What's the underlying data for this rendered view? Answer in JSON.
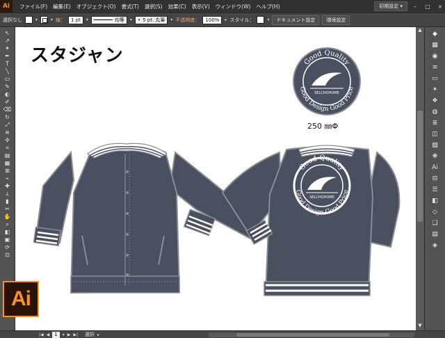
{
  "app": {
    "logo": "Ai",
    "badge": "Ai"
  },
  "menu": [
    "ファイル(F)",
    "編集(E)",
    "オブジェクト(O)",
    "書式(T)",
    "選択(S)",
    "効果(C)",
    "表示(V)",
    "ウィンドウ(W)",
    "ヘルプ(H)"
  ],
  "menubar_right": {
    "workspace": "初期設定",
    "workspace_caret": "▾",
    "minimize": "–",
    "maximize": "□",
    "close": "×"
  },
  "control": {
    "selection": "選択なし",
    "stroke_label": "線：",
    "stroke_weight": "1 pt",
    "profile": "均等",
    "brush": "5 pt. 丸筆",
    "opacity_label": "不透明度：",
    "opacity": "100%",
    "style_label": "スタイル：",
    "doc_settings": "ドキュメント設定",
    "prefs": "環境設定"
  },
  "tools": [
    "↖",
    "↗",
    "✶",
    "✒",
    "T",
    "╲",
    "▭",
    "✎",
    "◐",
    "✐",
    "⌫",
    "↻",
    "⤢",
    "≋",
    "✣",
    "⌗",
    "▤",
    "▦",
    "⊞",
    "⌁",
    "✚",
    "⟂",
    "▮",
    "✂",
    "✋",
    "⌕",
    "◧",
    "▣",
    "⟳",
    "⊡"
  ],
  "canvas": {
    "title": "スタジャン",
    "size_label": "250 ㎜Φ",
    "emblem": {
      "arc_top": "Good Quality",
      "arc_bottom": "Good Design Good Price",
      "center": "SELCHOHOME"
    }
  },
  "right_panel": [
    "◆",
    "▦",
    "◉",
    "≡",
    "▭",
    "✶",
    "❖",
    "◍",
    "≣",
    "◫",
    "▧",
    "❋",
    "Ai",
    "⊟",
    "☰",
    "◧",
    "◇",
    "❏",
    "▤",
    "◈"
  ],
  "status": {
    "zoom": "",
    "artboard": "1",
    "mode": "選択"
  },
  "colors": {
    "jacket": "#4b5060",
    "outline": "#8a8d94",
    "rib": "#ffffff",
    "accent": "#f7931e"
  }
}
